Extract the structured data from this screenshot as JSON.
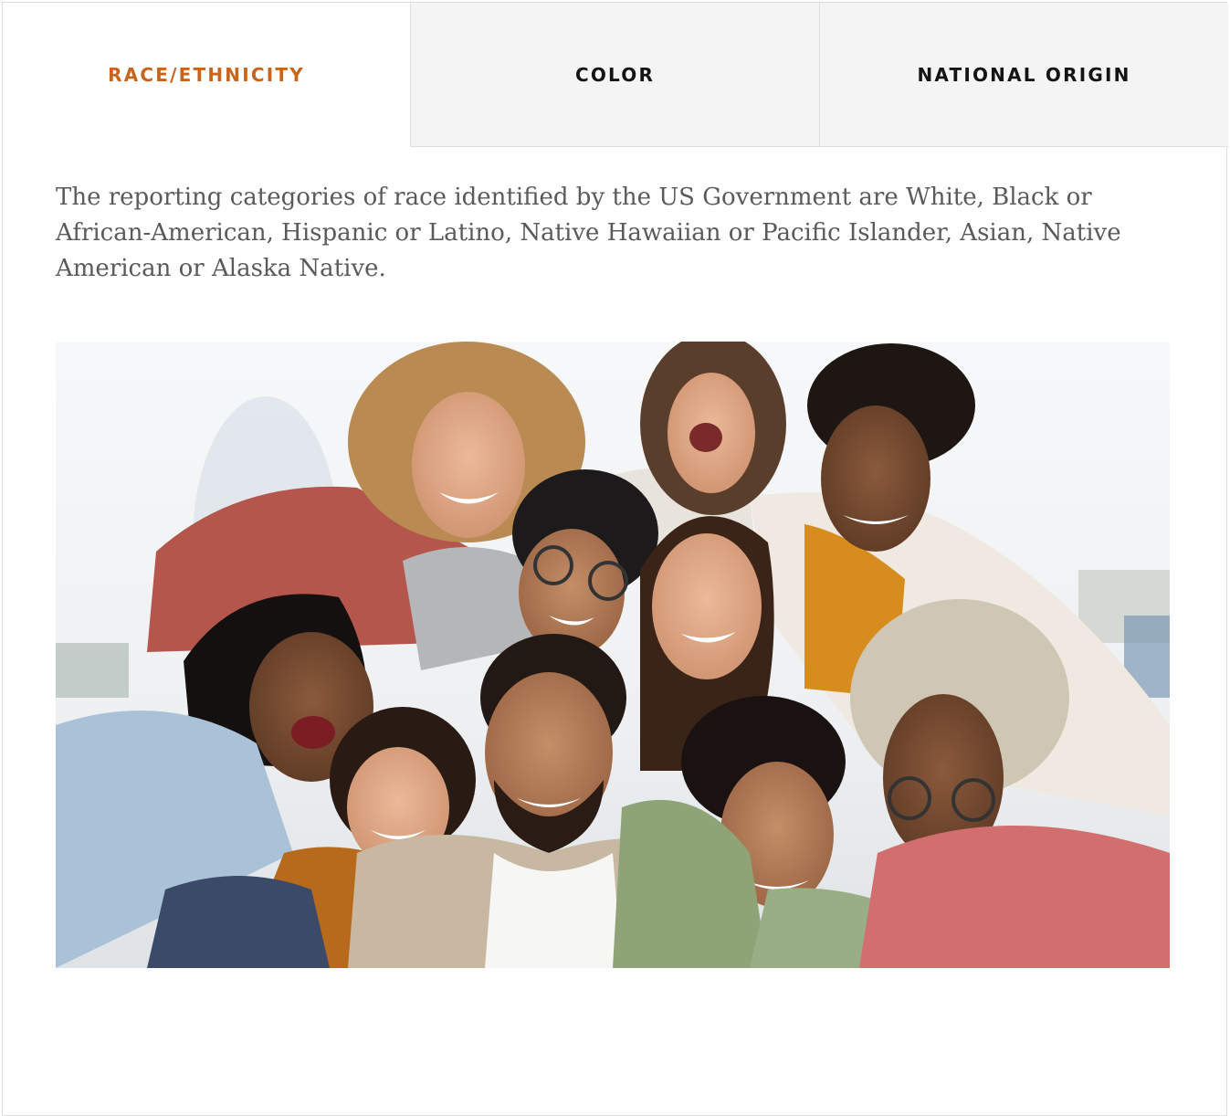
{
  "tabs": [
    {
      "label": "RACE/ETHNICITY",
      "active": true
    },
    {
      "label": "COLOR",
      "active": false
    },
    {
      "label": "NATIONAL ORIGIN",
      "active": false
    }
  ],
  "content": {
    "description": "The reporting categories of race identified by the US Government are White, Black or African-American, Hispanic or Latino, Native Hawaiian or Pacific Islander, Asian, Native American or Alaska Native."
  },
  "photo": {
    "subject": "group-of-diverse-young-friends-smiling"
  },
  "colors": {
    "accent": "#c8651b",
    "tab_text": "#141414",
    "tab_inactive_bg": "#f4f4f4",
    "body_text": "#5a5a5a",
    "border": "#dedede"
  }
}
